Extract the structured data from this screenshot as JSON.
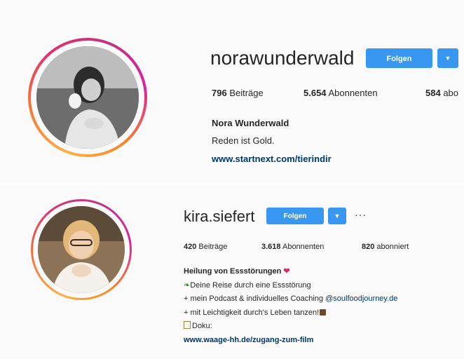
{
  "profile1": {
    "username": "norawunderwald",
    "follow_label": "Folgen",
    "stats": {
      "posts_num": "796",
      "posts_label": "Beiträge",
      "followers_num": "5.654",
      "followers_label": "Abonnenten",
      "following_num": "584",
      "following_label": "abo"
    },
    "full_name": "Nora Wunderwald",
    "bio": "Reden ist Gold.",
    "link": "www.startnext.com/tierindir"
  },
  "profile2": {
    "username": "kira.siefert",
    "follow_label": "Folgen",
    "more_label": "···",
    "stats": {
      "posts_num": "420",
      "posts_label": "Beiträge",
      "followers_num": "3.618",
      "followers_label": "Abonnenten",
      "following_num": "820",
      "following_label": "abonniert"
    },
    "bio": {
      "headline": "Heilung von Essstörungen",
      "line1": "Deine Reise durch eine Essstörung",
      "line2_prefix": "+ mein Podcast & individuelles Coaching ",
      "line2_mention": "@soulfoodjourney.de",
      "line3": "+ mit Leichtigkeit durch's Leben tanzen!",
      "line4": "Doku:"
    },
    "link": "www.waage-hh.de/zugang-zum-film"
  },
  "icons": {
    "dropdown": "chevron-down-icon",
    "more": "more-horizontal-icon"
  },
  "colors": {
    "follow_button": "#3897f0",
    "link": "#00376b",
    "story_ring_start": "#fdb046",
    "story_ring_end": "#c13584"
  }
}
